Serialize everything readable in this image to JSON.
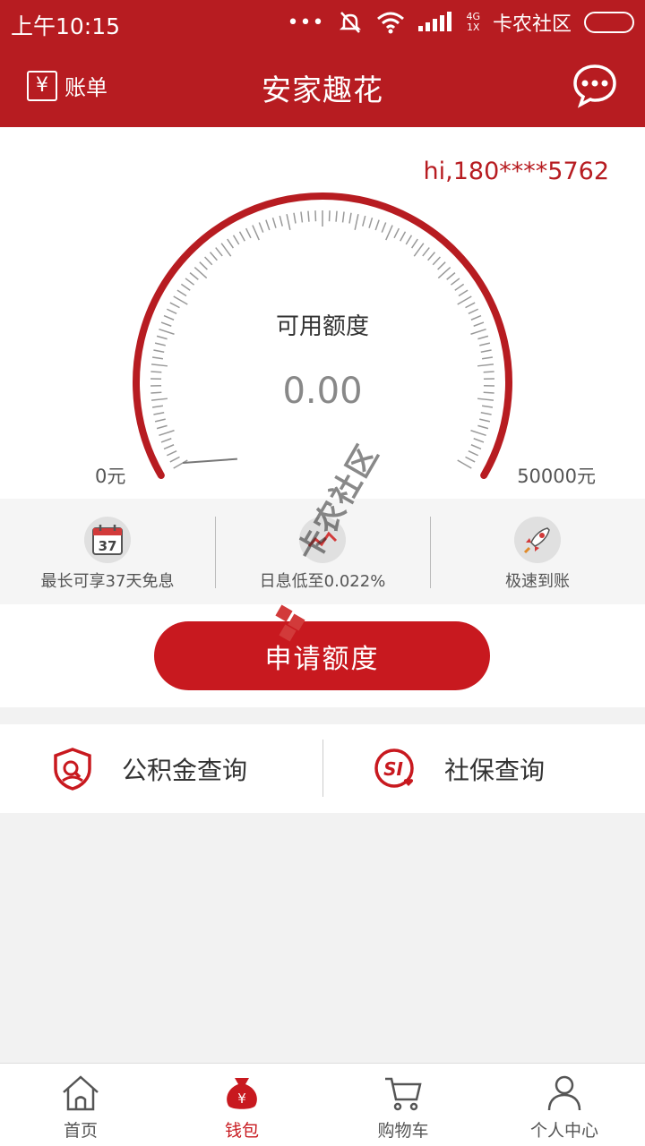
{
  "status_bar": {
    "time": "上午10:15",
    "network": "4G",
    "sim": "1X",
    "carrier": "卡农社区"
  },
  "header": {
    "bill_label": "账单",
    "bill_icon": "¥",
    "title": "安家趣花"
  },
  "credit": {
    "greeting": "hi,180****5762",
    "label": "可用额度",
    "value": "0.00",
    "min": "0元",
    "max": "50000元",
    "used_fraction": 0
  },
  "features": [
    {
      "label": "最长可享37天免息",
      "icon": "calendar-icon",
      "day": "37"
    },
    {
      "label": "日息低至0.022%",
      "icon": "chart-icon"
    },
    {
      "label": "极速到账",
      "icon": "rocket-icon"
    }
  ],
  "apply": {
    "label": "申请额度"
  },
  "queries": [
    {
      "label": "公积金查询",
      "icon": "shield-search-icon"
    },
    {
      "label": "社保查询",
      "icon": "social-security-icon",
      "badge": "SI"
    }
  ],
  "nav": [
    {
      "label": "首页",
      "icon": "home-icon"
    },
    {
      "label": "钱包",
      "icon": "wallet-icon",
      "active": true
    },
    {
      "label": "购物车",
      "icon": "cart-icon"
    },
    {
      "label": "个人中心",
      "icon": "profile-icon"
    }
  ],
  "watermark": {
    "text": "卡农社区"
  },
  "colors": {
    "brand": "#b71c21",
    "button": "#c8191f"
  }
}
